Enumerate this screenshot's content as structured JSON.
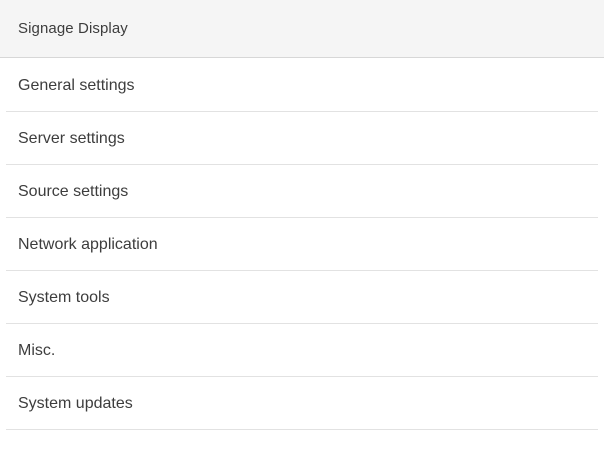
{
  "header": {
    "title": "Signage Display"
  },
  "menu": {
    "items": [
      {
        "label": "General settings"
      },
      {
        "label": "Server settings"
      },
      {
        "label": "Source settings"
      },
      {
        "label": "Network application"
      },
      {
        "label": "System tools"
      },
      {
        "label": "Misc."
      },
      {
        "label": "System updates"
      }
    ]
  },
  "colors": {
    "background": "#ffffff",
    "header_background": "#f5f5f5",
    "divider": "#e2e2e2",
    "text": "#3d3d3d"
  }
}
